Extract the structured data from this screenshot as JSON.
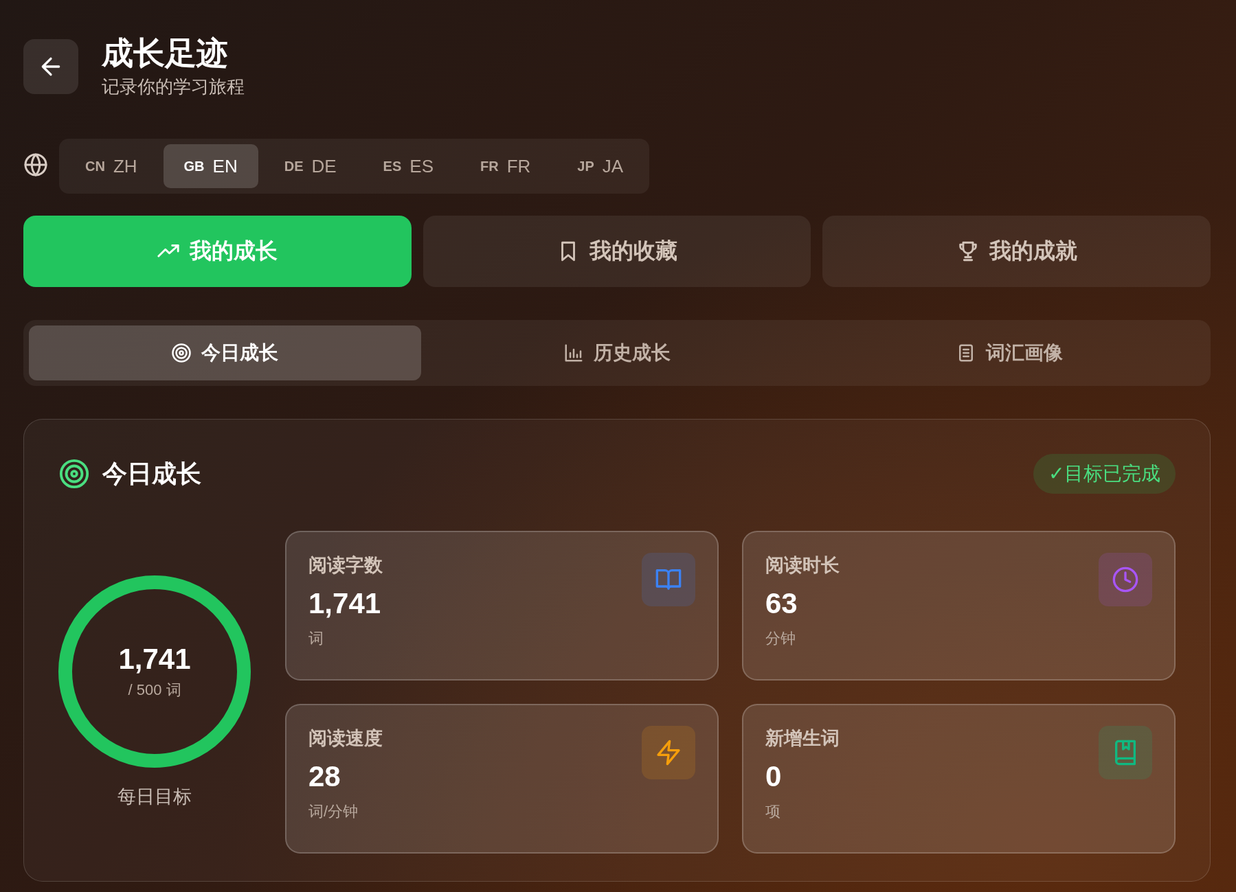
{
  "header": {
    "title": "成长足迹",
    "subtitle": "记录你的学习旅程"
  },
  "languages": [
    {
      "code": "CN",
      "label": "ZH",
      "selected": false
    },
    {
      "code": "GB",
      "label": "EN",
      "selected": true
    },
    {
      "code": "DE",
      "label": "DE",
      "selected": false
    },
    {
      "code": "ES",
      "label": "ES",
      "selected": false
    },
    {
      "code": "FR",
      "label": "FR",
      "selected": false
    },
    {
      "code": "JP",
      "label": "JA",
      "selected": false
    }
  ],
  "main_tabs": [
    {
      "kind": "trend",
      "label": "我的成长",
      "selected": true
    },
    {
      "kind": "bookmark",
      "label": "我的收藏",
      "selected": false
    },
    {
      "kind": "trophy",
      "label": "我的成就",
      "selected": false
    }
  ],
  "sub_tabs": [
    {
      "kind": "target",
      "label": "今日成长",
      "selected": true
    },
    {
      "kind": "chart",
      "label": "历史成长",
      "selected": false
    },
    {
      "kind": "list",
      "label": "词汇画像",
      "selected": false
    }
  ],
  "today": {
    "title": "今日成长",
    "badge": "✓目标已完成",
    "goal": {
      "value": "1,741",
      "target": "/ 500 词",
      "caption": "每日目标",
      "level": 1
    },
    "stats": [
      {
        "kind": "book",
        "color": "#3b82f6",
        "label": "阅读字数",
        "value": "1,741",
        "unit": "词"
      },
      {
        "kind": "clock",
        "color": "#a855f7",
        "label": "阅读时长",
        "value": "63",
        "unit": "分钟"
      },
      {
        "kind": "bolt",
        "color": "#f59e0b",
        "label": "阅读速度",
        "value": "28",
        "unit": "词/分钟"
      },
      {
        "kind": "notebook",
        "color": "#10b981",
        "label": "新增生词",
        "value": "0",
        "unit": "项"
      }
    ]
  }
}
